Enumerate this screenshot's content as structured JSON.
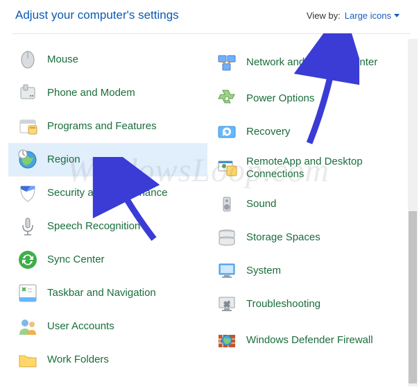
{
  "header": {
    "title": "Adjust your computer's settings",
    "viewby_label": "View by:",
    "viewby_value": "Large icons"
  },
  "left_items": [
    {
      "icon": "mouse-icon",
      "label": "Mouse"
    },
    {
      "icon": "phone-modem-icon",
      "label": "Phone and Modem"
    },
    {
      "icon": "programs-icon",
      "label": "Programs and Features"
    },
    {
      "icon": "region-icon",
      "label": "Region",
      "selected": true
    },
    {
      "icon": "security-icon",
      "label": "Security and Maintenance"
    },
    {
      "icon": "speech-icon",
      "label": "Speech Recognition"
    },
    {
      "icon": "sync-icon",
      "label": "Sync Center"
    },
    {
      "icon": "taskbar-icon",
      "label": "Taskbar and Navigation"
    },
    {
      "icon": "user-icon",
      "label": "User Accounts"
    },
    {
      "icon": "work-folders-icon",
      "label": "Work Folders"
    }
  ],
  "right_items": [
    {
      "icon": "network-icon",
      "label": "Network and Sharing Center",
      "tall": true
    },
    {
      "icon": "power-icon",
      "label": "Power Options"
    },
    {
      "icon": "recovery-icon",
      "label": "Recovery"
    },
    {
      "icon": "remote-icon",
      "label": "RemoteApp and Desktop Connections",
      "tall": true
    },
    {
      "icon": "sound-icon",
      "label": "Sound"
    },
    {
      "icon": "storage-icon",
      "label": "Storage Spaces"
    },
    {
      "icon": "system-icon",
      "label": "System"
    },
    {
      "icon": "trouble-icon",
      "label": "Troubleshooting"
    },
    {
      "icon": "firewall-icon",
      "label": "Windows Defender Firewall",
      "tall": true
    }
  ],
  "watermark": "WindowsLoop.com"
}
